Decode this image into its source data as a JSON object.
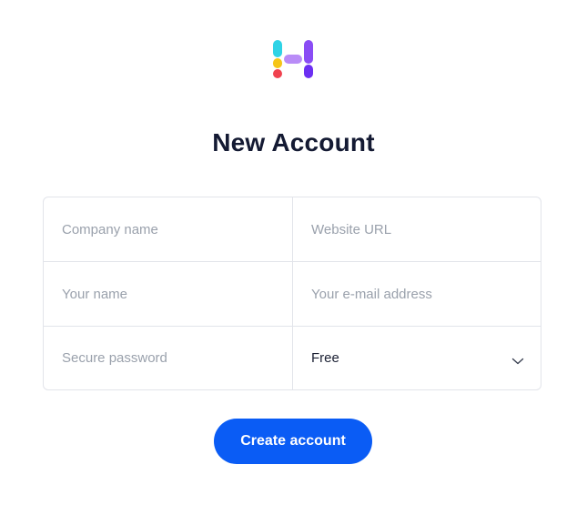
{
  "logo": {
    "icon": "h-logo-icon",
    "colors": [
      "#2ed3e6",
      "#f5c518",
      "#f0424f",
      "#b98cf7",
      "#6c2ff2"
    ]
  },
  "header": {
    "title": "New Account"
  },
  "form": {
    "company_name": {
      "placeholder": "Company name",
      "value": ""
    },
    "website_url": {
      "placeholder": "Website URL",
      "value": ""
    },
    "your_name": {
      "placeholder": "Your name",
      "value": ""
    },
    "email": {
      "placeholder": "Your e-mail address",
      "value": ""
    },
    "password": {
      "placeholder": "Secure password",
      "value": ""
    },
    "plan": {
      "selected": "Free",
      "icon": "chevron-down-icon"
    }
  },
  "actions": {
    "create_label": "Create account",
    "accent": "#0a5cf5"
  }
}
